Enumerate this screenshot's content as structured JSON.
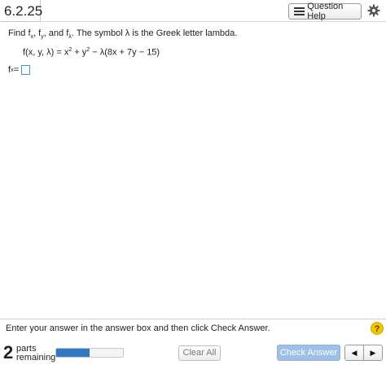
{
  "header": {
    "question_number": "6.2.25",
    "help_label": "Question Help"
  },
  "question": {
    "prompt_find": "Find f",
    "prompt_sub_x": "x",
    "prompt_comma1": ", f",
    "prompt_sub_y": "y",
    "prompt_and": ", and f",
    "prompt_sub_lambda": "λ",
    "prompt_rest": ". The symbol λ is the Greek letter lambda.",
    "formula_lhs": "f(x, y, λ) = x",
    "formula_exp1": "2",
    "formula_mid": " + y",
    "formula_exp2": "2",
    "formula_rhs": " − λ(8x + 7y − 15)",
    "answer_label": "f",
    "answer_sub": "x",
    "answer_eq": " ="
  },
  "footer": {
    "instruction": "Enter your answer in the answer box and then click Check Answer.",
    "help_mark": "?",
    "parts_count": "2",
    "parts_word": "parts",
    "remaining_word": "remaining",
    "progress_fraction": 0.5,
    "clear_label": "Clear All",
    "check_label": "Check Answer",
    "prev_symbol": "◀",
    "next_symbol": "▶"
  },
  "colors": {
    "accent": "#2f78c2",
    "check_button": "#9dc0e4",
    "help_badge": "#f2c500",
    "answer_box_border": "#4a8fd6"
  },
  "icons": [
    "list-icon",
    "gear-icon",
    "help-icon",
    "prev-arrow-icon",
    "next-arrow-icon"
  ]
}
